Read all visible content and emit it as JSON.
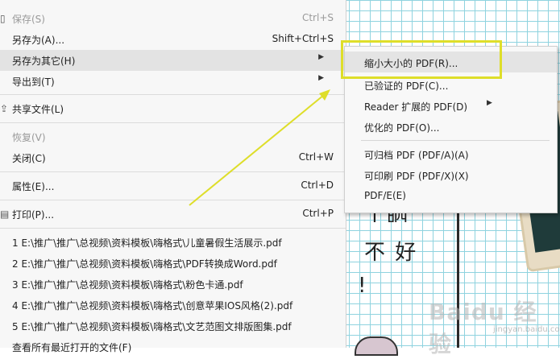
{
  "main_menu": {
    "items": [
      {
        "label": "保存(S)",
        "shortcut": "Ctrl+S",
        "disabled": true
      },
      {
        "label": "另存为(A)...",
        "shortcut": "Shift+Ctrl+S"
      },
      {
        "label": "另存为其它(H)",
        "submenu": true,
        "highlighted": true
      },
      {
        "label": "导出到(T)",
        "submenu": true
      },
      {
        "label": "共享文件(L)",
        "icon": "share-icon"
      },
      {
        "label": "恢复(V)",
        "disabled": true
      },
      {
        "label": "关闭(C)",
        "shortcut": "Ctrl+W"
      },
      {
        "label": "属性(E)...",
        "shortcut": "Ctrl+D"
      },
      {
        "label": "打印(P)...",
        "shortcut": "Ctrl+P",
        "icon": "printer-icon"
      }
    ],
    "recent_files": [
      "1 E:\\推广\\推广\\总视频\\资料模板\\嗨格式\\儿童暑假生活展示.pdf",
      "2 E:\\推广\\推广\\总视频\\资料模板\\嗨格式\\PDF转换成Word.pdf",
      "3 E:\\推广\\推广\\总视频\\资料模板\\嗨格式\\粉色卡通.pdf",
      "4 E:\\推广\\推广\\总视频\\资料模板\\嗨格式\\创意苹果IOS风格(2).pdf",
      "5 E:\\推广\\推广\\总视频\\资料模板\\嗨格式\\文艺范图文排版图集.pdf"
    ],
    "more_recent_label": "查看所有最近打开的文件(F)"
  },
  "submenu": {
    "items": [
      {
        "label": "缩小大小的 PDF(R)...",
        "highlighted": true
      },
      {
        "label": "已验证的 PDF(C)..."
      },
      {
        "label": "Reader 扩展的 PDF(D)",
        "submenu": true
      },
      {
        "label": "优化的 PDF(O)..."
      },
      {
        "label": "可归档 PDF (PDF/A)(A)"
      },
      {
        "label": "可印刷 PDF (PDF/X)(X)"
      },
      {
        "label": "PDF/E(E)"
      }
    ]
  },
  "document": {
    "line1": "工晒",
    "line2": "不 好",
    "line3": "!",
    "watermark": "Baidu 经验",
    "watermark_sub": "jingyan.baidu.com"
  },
  "colors": {
    "annotation": "#dede2a",
    "grid": "#8fd3df",
    "highlight": "#e3e3e3"
  }
}
